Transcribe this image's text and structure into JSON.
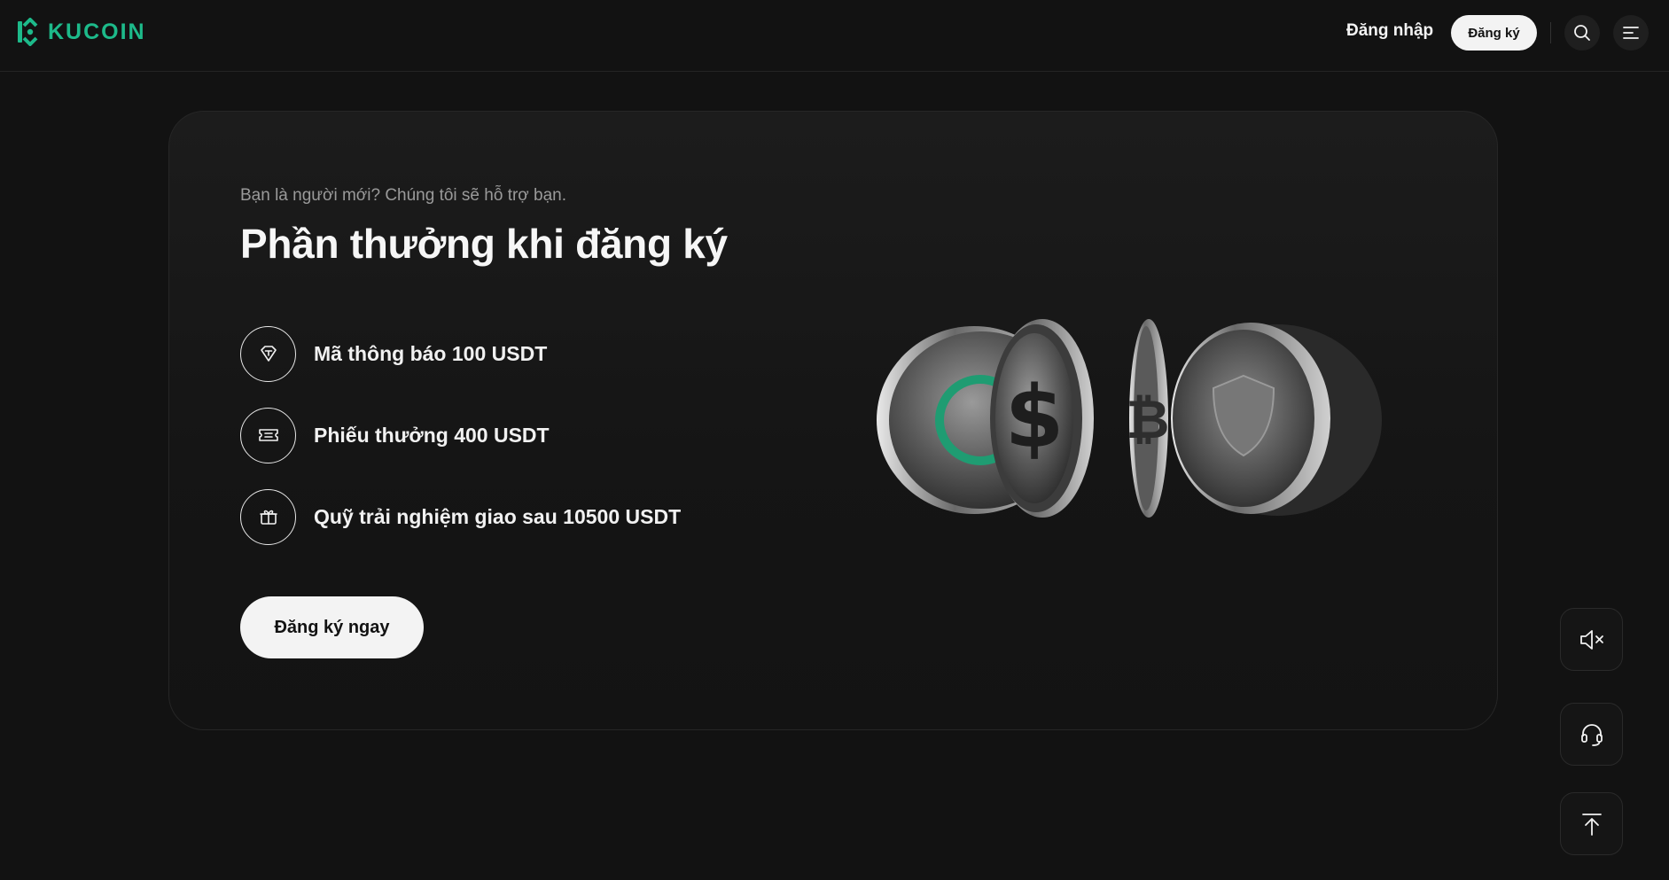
{
  "header": {
    "brand": "KUCOIN",
    "login_label": "Đăng nhập",
    "signup_label": "Đăng ký",
    "icons": [
      "search-icon",
      "menu-icon"
    ]
  },
  "hero": {
    "subtitle": "Bạn là người mới? Chúng tôi sẽ hỗ trợ bạn.",
    "title": "Phần thưởng khi đăng ký",
    "rewards": [
      {
        "icon": "diamond-icon",
        "label": "Mã thông báo 100 USDT"
      },
      {
        "icon": "ticket-icon",
        "label": "Phiếu thưởng 400 USDT"
      },
      {
        "icon": "gift-icon",
        "label": "Quỹ trải nghiệm giao sau 10500 USDT"
      }
    ],
    "cta_label": "Đăng ký ngay",
    "illustration_icons": [
      "ring-coin-icon",
      "dollar-coin-icon",
      "bitcoin-coin-icon",
      "shield-coin-icon"
    ]
  },
  "floating_actions": [
    "sound-mute-icon",
    "support-headset-icon",
    "back-to-top-icon"
  ],
  "colors": {
    "background": "#121212",
    "brand_green": "#1dba8a",
    "card": "#1a1a1a",
    "button_light": "#f3f3f3"
  }
}
